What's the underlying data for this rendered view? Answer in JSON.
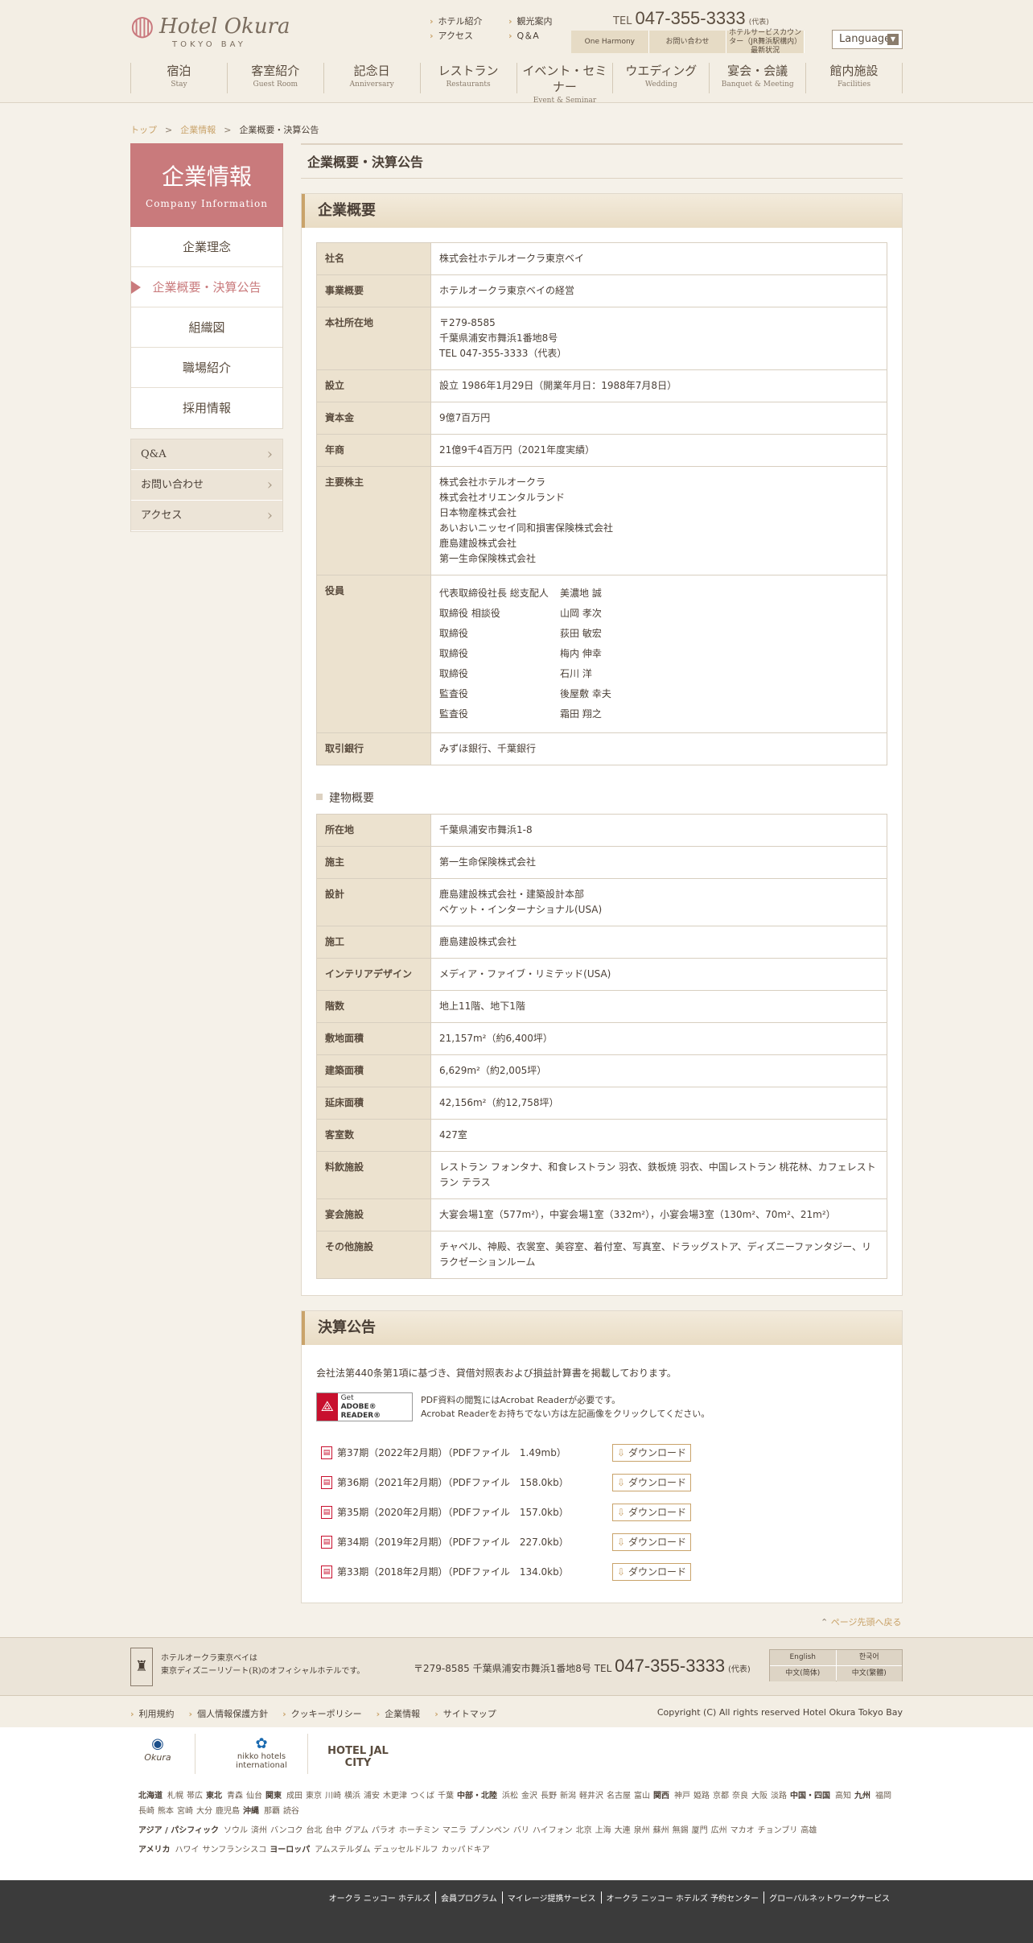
{
  "header": {
    "logo_name": "Hotel Okura",
    "logo_sub": "TOKYO BAY",
    "toplinks_left": [
      "ホテル紹介",
      "アクセス"
    ],
    "toplinks_right": [
      "観光案内",
      "Q＆A"
    ],
    "tel_prefix": "TEL",
    "tel_number": "047-355-3333",
    "tel_suffix": "(代表)",
    "buttons": [
      "One Harmony",
      "お問い合わせ",
      "ホテルサービスカウンター（JR舞浜駅構内）最新状況"
    ],
    "language": "Language",
    "nav": [
      {
        "jp": "宿泊",
        "en": "Stay"
      },
      {
        "jp": "客室紹介",
        "en": "Guest Room"
      },
      {
        "jp": "記念日",
        "en": "Anniversary"
      },
      {
        "jp": "レストラン",
        "en": "Restaurants"
      },
      {
        "jp": "イベント・セミナー",
        "en": "Event & Seminar"
      },
      {
        "jp": "ウエディング",
        "en": "Wedding"
      },
      {
        "jp": "宴会・会議",
        "en": "Banquet & Meeting"
      },
      {
        "jp": "館内施設",
        "en": "Facilities"
      }
    ]
  },
  "breadcrumb": {
    "top": "トップ",
    "company": "企業情報",
    "current": "企業概要・決算公告",
    "sep": ">"
  },
  "sidebar": {
    "title_jp": "企業情報",
    "title_en": "Company Information",
    "items": [
      "企業理念",
      "企業概要・決算公告",
      "組織図",
      "職場紹介",
      "採用情報"
    ],
    "sub": [
      "Q&A",
      "お問い合わせ",
      "アクセス"
    ]
  },
  "main": {
    "page_title": "企業概要・決算公告",
    "company": {
      "heading": "企業概要",
      "name_label": "社名",
      "name": "株式会社ホテルオークラ東京ベイ",
      "business_label": "事業概要",
      "business": "ホテルオークラ東京ベイの経営",
      "hq_label": "本社所在地",
      "hq1": "〒279-8585",
      "hq2": "千葉県浦安市舞浜1番地8号",
      "hq3": "TEL 047-355-3333（代表）",
      "est_label": "設立",
      "est": "設立 1986年1月29日（開業年月日：1988年7月8日）",
      "capital_label": "資本金",
      "capital": "9億7百万円",
      "sales_label": "年商",
      "sales": "21億9千4百万円（2021年度実績）",
      "holders_label": "主要株主",
      "holders": [
        "株式会社ホテルオークラ",
        "株式会社オリエンタルランド",
        "日本物産株式会社",
        "あいおいニッセイ同和損害保険株式会社",
        "鹿島建設株式会社",
        "第一生命保険株式会社"
      ],
      "officers_label": "役員",
      "officers": [
        {
          "role": "代表取締役社長 総支配人",
          "name": "美濃地 誠"
        },
        {
          "role": "取締役 相談役",
          "name": "山岡 孝次"
        },
        {
          "role": "取締役",
          "name": "荻田 敏宏"
        },
        {
          "role": "取締役",
          "name": "梅内 伸幸"
        },
        {
          "role": "取締役",
          "name": "石川 洋"
        },
        {
          "role": "監査役",
          "name": "後屋敷 幸夫"
        },
        {
          "role": "監査役",
          "name": "霜田 翔之"
        }
      ],
      "bank_label": "取引銀行",
      "bank": "みずほ銀行、千葉銀行"
    },
    "building": {
      "heading": "建物概要",
      "rows": [
        {
          "label": "所在地",
          "value": "千葉県浦安市舞浜1-8"
        },
        {
          "label": "施主",
          "value": "第一生命保険株式会社"
        },
        {
          "label": "設計",
          "value": "鹿島建設株式会社・建築設計本部",
          "value2": "ベケット・インターナショナル(USA)"
        },
        {
          "label": "施工",
          "value": "鹿島建設株式会社"
        },
        {
          "label": "インテリアデザイン",
          "value": "メディア・ファイブ・リミテッド(USA)"
        },
        {
          "label": "階数",
          "value": "地上11階、地下1階"
        },
        {
          "label": "敷地面積",
          "value": "21,157m²（約6,400坪）"
        },
        {
          "label": "建築面積",
          "value": "6,629m²（約2,005坪）"
        },
        {
          "label": "延床面積",
          "value": "42,156m²（約12,758坪）"
        },
        {
          "label": "客室数",
          "value": "427室"
        },
        {
          "label": "料飲施設",
          "value": "レストラン フォンタナ、和食レストラン 羽衣、鉄板焼 羽衣、中国レストラン 桃花林、カフェレストラン テラス"
        },
        {
          "label": "宴会施設",
          "value": "大宴会場1室（577m²），中宴会場1室（332m²），小宴会場3室（130m²、70m²、21m²）"
        },
        {
          "label": "その他施設",
          "value": "チャペル、神殿、衣裳室、美容室、着付室、写真室、ドラッグストア、ディズニーファンタジー、リラクゼーションルーム"
        }
      ]
    },
    "financial": {
      "heading": "決算公告",
      "intro": "会社法第440条第1項に基づき、貸借対照表および損益計算書を掲載しております。",
      "adobe_badge_line1": "Get",
      "adobe_badge_line2": "ADOBE® READER®",
      "adobe_note1": "PDF資料の閲覧にはAcrobat Readerが必要です。",
      "adobe_note2": "Acrobat Readerをお持ちでない方は左記画像をクリックしてください。",
      "download_label": "ダウンロード",
      "items": [
        "第37期（2022年2月期）（PDFファイル　1.49mb）",
        "第36期（2021年2月期）（PDFファイル　158.0kb）",
        "第35期（2020年2月期）（PDFファイル　157.0kb）",
        "第34期（2019年2月期）（PDFファイル　227.0kb）",
        "第33期（2018年2月期）（PDFファイル　134.0kb）"
      ]
    },
    "pagetop": "ページ先頭へ戻る"
  },
  "footer": {
    "desc1": "ホテルオークラ東京ベイは",
    "desc2": "東京ディズニーリゾート(R)のオフィシャルホテルです。",
    "address": "〒279-8585 千葉県浦安市舞浜1番地8号",
    "tel_prefix": "TEL",
    "tel": "047-355-3333",
    "tel_suffix": "(代表)",
    "langs": [
      "English",
      "한국어",
      "中文(简体)",
      "中文(繁體)"
    ],
    "links": [
      "利用規約",
      "個人情報保護方針",
      "クッキーポリシー",
      "企業情報",
      "サイトマップ"
    ],
    "copyright": "Copyright (C) All rights reserved Hotel Okura Tokyo Bay",
    "brands": [
      "Okura",
      "nikko hotels international",
      "HOTEL JAL CITY"
    ],
    "regions": [
      {
        "name": "北海道",
        "cities": [
          "札幌",
          "帯広"
        ]
      },
      {
        "name": "東北",
        "cities": [
          "青森",
          "仙台"
        ]
      },
      {
        "name": "関東",
        "cities": [
          "成田",
          "東京",
          "川崎",
          "横浜",
          "浦安",
          "木更津",
          "つくば",
          "千葉"
        ]
      },
      {
        "name": "中部・北陸",
        "cities": [
          "浜松",
          "金沢",
          "長野",
          "新潟",
          "軽井沢",
          "名古屋",
          "富山"
        ]
      },
      {
        "name": "関西",
        "cities": [
          "神戸",
          "姫路",
          "京都",
          "奈良",
          "大阪",
          "淡路"
        ]
      },
      {
        "name": "中国・四国",
        "cities": [
          "高知"
        ]
      },
      {
        "name": "九州",
        "cities": [
          "福岡",
          "長崎",
          "熊本",
          "宮崎",
          "大分",
          "鹿児島"
        ]
      },
      {
        "name": "沖縄",
        "cities": [
          "那覇",
          "読谷"
        ]
      }
    ],
    "regions_asia": [
      {
        "name": "アジア / パシフィック",
        "cities": [
          "ソウル",
          "済州",
          "バンコク",
          "台北",
          "台中",
          "グアム",
          "パラオ",
          "ホーチミン",
          "マニラ",
          "プノンペン",
          "バリ",
          "ハイフォン",
          "北京",
          "上海",
          "大連",
          "泉州",
          "蘇州",
          "無錫",
          "厦門",
          "広州",
          "マカオ",
          "チョンブリ",
          "高雄"
        ]
      }
    ],
    "regions_west": [
      {
        "name": "アメリカ",
        "cities": [
          "ハワイ",
          "サンフランシスコ"
        ]
      },
      {
        "name": "ヨーロッパ",
        "cities": [
          "アムステルダム",
          "デュッセルドルフ",
          "カッパドキア"
        ]
      }
    ],
    "bottom_links": [
      "オークラ ニッコー ホテルズ",
      "会員プログラム",
      "マイレージ提携サービス",
      "オークラ ニッコー ホテルズ 予約センター",
      "グローバルネットワークサービス"
    ]
  }
}
